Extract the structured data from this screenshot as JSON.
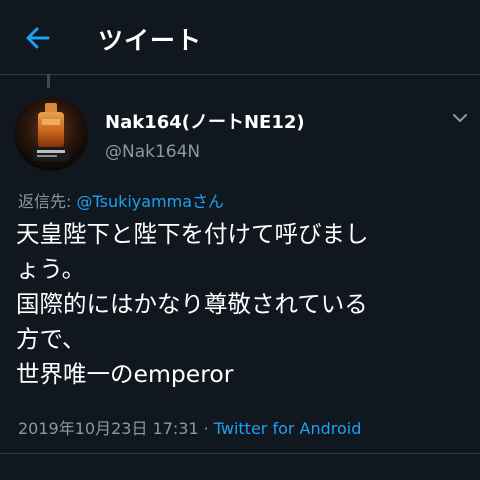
{
  "header": {
    "title": "ツイート",
    "back_icon": "arrow-left-icon"
  },
  "tweet": {
    "author": {
      "display_name": "Nak164(ノートNE12)",
      "handle": "@Nak164N"
    },
    "reply": {
      "prefix": "返信先: ",
      "mention": "@Tsukiyammaさん"
    },
    "text_lines": [
      "天皇陛下と陛下を付けて呼びまし",
      "ょう。",
      "国際的にはかなり尊敬されている",
      "方で、",
      "世界唯一のemperor"
    ],
    "timestamp": "2019年10月23日 17:31",
    "separator": "·",
    "source": "Twitter for Android"
  },
  "colors": {
    "background": "#10171e",
    "accent": "#1da1f2",
    "secondary_text": "#8899a6",
    "divider": "#2f3a44"
  }
}
